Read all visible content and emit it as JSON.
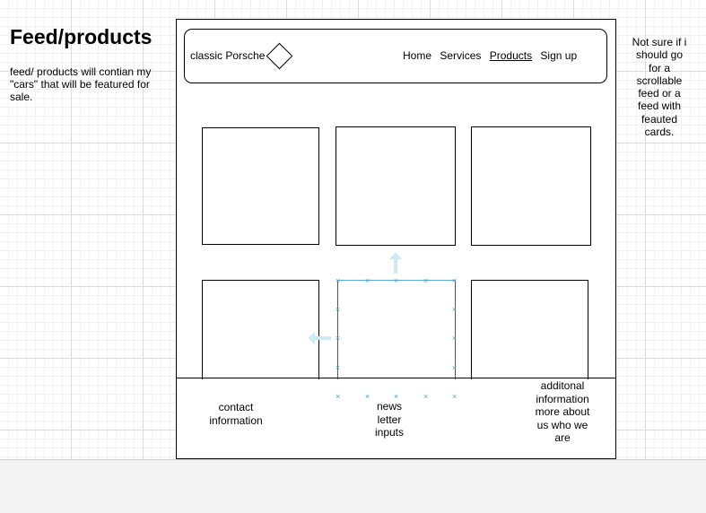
{
  "annotations": {
    "title": "Feed/products",
    "description": "feed/ products will contian my \"cars\" that will be featured for sale.",
    "note": "Not sure if i should go for a scrollable feed or a feed with feauted cards."
  },
  "wireframe": {
    "brand": "classic Porsche",
    "nav": [
      "Home",
      "Services",
      "Products",
      "Sign up"
    ],
    "active_nav_index": 2,
    "footer": {
      "contact": "contact information",
      "newsletter": "news letter inputs",
      "additional": "additonal information more about us who we are"
    }
  },
  "colors": {
    "selection": "#3aa6dd",
    "stroke": "#000000"
  },
  "icons": {
    "logo": "diamond-shape",
    "selection_handle": "x-marker",
    "connector": "arrow"
  }
}
